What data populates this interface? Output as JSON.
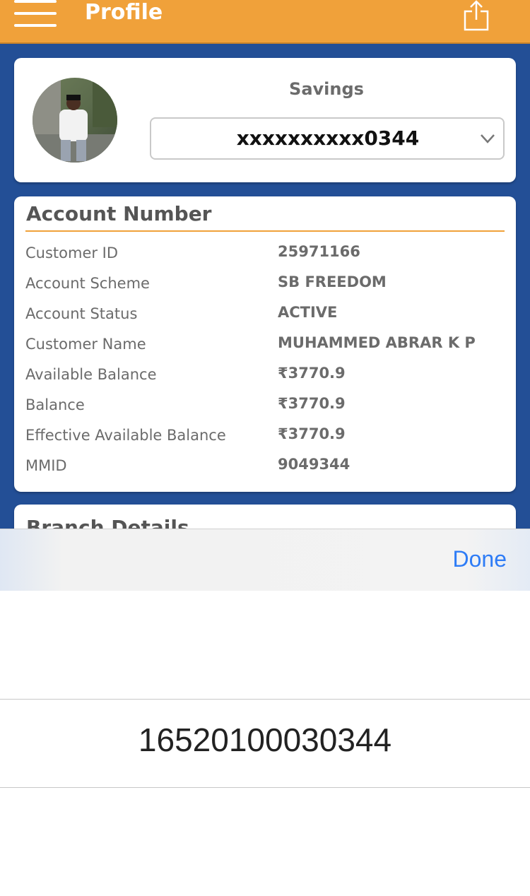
{
  "header": {
    "title": "Profile",
    "menu_icon": "hamburger-menu-icon",
    "share_icon": "share-icon"
  },
  "profile": {
    "account_type": "Savings",
    "selected_account": "xxxxxxxxxx0344"
  },
  "account_section": {
    "title": "Account Number",
    "rows": [
      {
        "label": "Customer ID",
        "value": "25971166"
      },
      {
        "label": "Account Scheme",
        "value": "SB FREEDOM"
      },
      {
        "label": "Account Status",
        "value": "ACTIVE"
      },
      {
        "label": "Customer Name",
        "value": "MUHAMMED ABRAR K P"
      },
      {
        "label": "Available Balance",
        "value": "₹3770.9"
      },
      {
        "label": "Balance",
        "value": "₹3770.9"
      },
      {
        "label": "Effective Available Balance",
        "value": "₹3770.9"
      },
      {
        "label": "MMID",
        "value": "9049344"
      }
    ]
  },
  "branch_section": {
    "title": "Branch Details"
  },
  "picker": {
    "done_label": "Done",
    "selected_value": "16520100030344"
  },
  "colors": {
    "header": "#f0a13a",
    "background": "#234f96",
    "accent_line": "#f0a13a",
    "done": "#2e7cf6"
  }
}
